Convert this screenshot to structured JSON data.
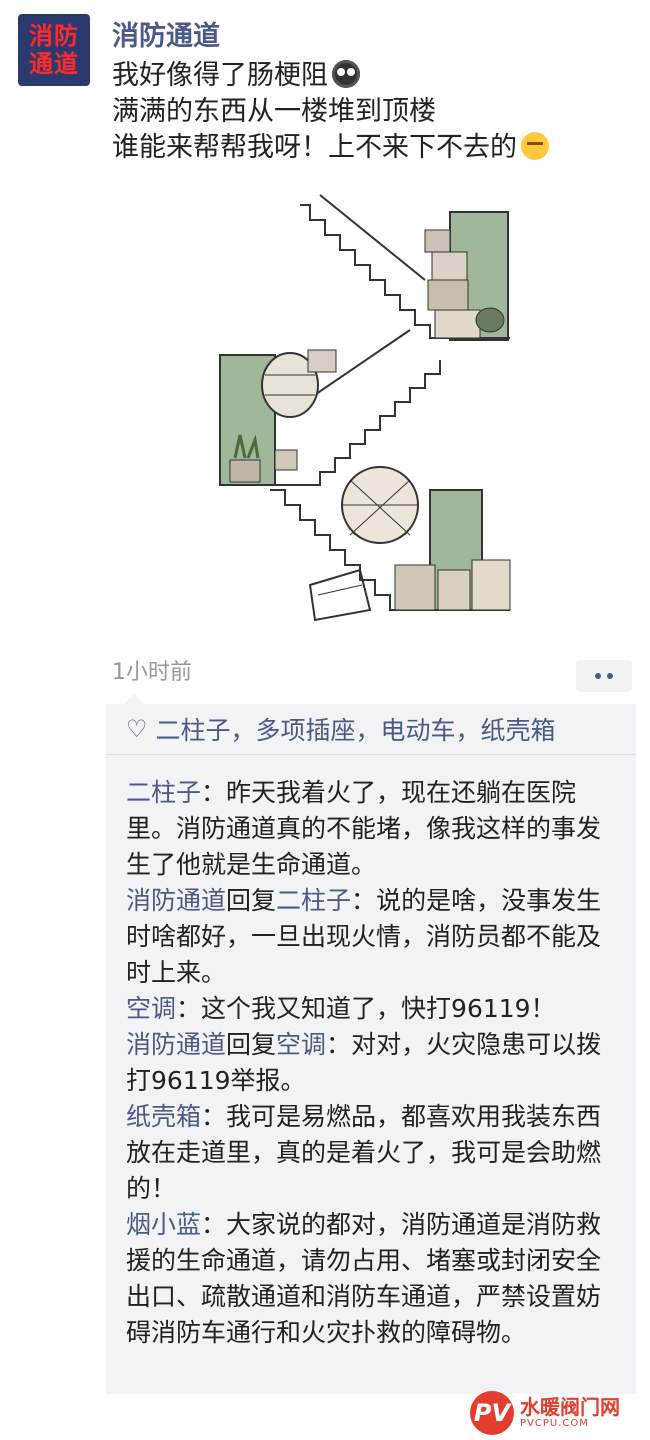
{
  "avatar": {
    "line1": "消防",
    "line2": "通道"
  },
  "post": {
    "author": "消防通道",
    "lines": [
      "我好像得了肠梗阻",
      "满满的东西从一楼堆到顶楼",
      "谁能来帮帮我呀！上不来下不去的"
    ],
    "emoji1": "sad-face-emoji",
    "emoji2": "angry-face-emoji",
    "time": "1小时前"
  },
  "likes": {
    "text": "二柱子，多项插座，电动车，纸壳箱"
  },
  "comments": [
    {
      "name": "二柱子",
      "sep": "：",
      "text": "昨天我着火了，现在还躺在医院里。消防通道真的不能堵，像我这样的事发生了他就是生命通道。"
    },
    {
      "name": "消防通道",
      "reply_word": "回复",
      "reply_to": "二柱子",
      "sep": "：",
      "text": "说的是啥，没事发生时啥都好，一旦出现火情，消防员都不能及时上来。"
    },
    {
      "name": "空调",
      "sep": "：",
      "text": "这个我又知道了，快打96119！"
    },
    {
      "name": "消防通道",
      "reply_word": "回复",
      "reply_to": "空调",
      "sep": "：",
      "text": "对对，火灾隐患可以拨打96119举报。"
    },
    {
      "name": "纸壳箱",
      "sep": "：",
      "text": "我可是易燃品，都喜欢用我装东西放在走道里，真的是着火了，我可是会助燃的！"
    },
    {
      "name": "烟小蓝",
      "sep": "：",
      "text": "大家说的都对，消防通道是消防救援的生命通道，请勿占用、堵塞或封闭安全出口、疏散通道和消防车通道，严禁设置妨碍消防车通行和火灾扑救的障碍物。"
    }
  ],
  "watermark": {
    "logo": "PV",
    "name": "水暖阀门网",
    "site": "PVCPU.COM"
  },
  "colors": {
    "link": "#4a5a8a",
    "avatar_bg": "#2b3a6e",
    "avatar_text": "#ff2a2a"
  }
}
